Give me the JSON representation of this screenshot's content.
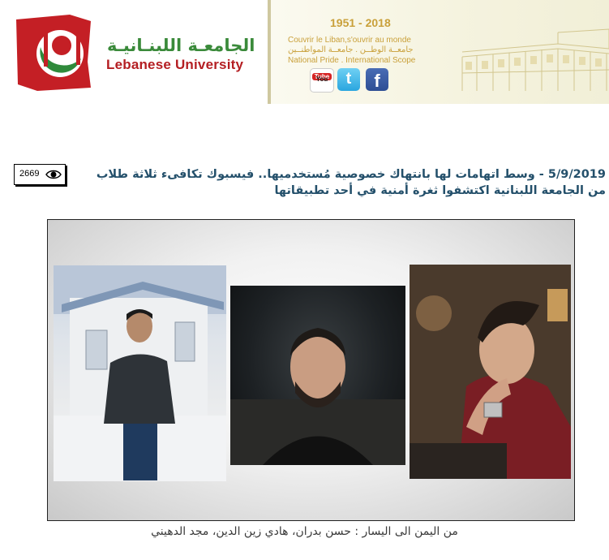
{
  "header": {
    "university_ar": "الجامعـة اللبنـانيـة",
    "university_en": "Lebanese University",
    "years": "1951 - 2018",
    "motto_fr": "Couvrir le Liban,s'ouvrir au monde",
    "motto_ar": "جامعــة الوطــن . جامعــة المواطنــين",
    "motto_en": "National Pride . International Scope",
    "social": {
      "youtube_top": "You",
      "youtube_bottom": "Tube",
      "twitter": "t",
      "facebook": "f"
    }
  },
  "article": {
    "views": "2669",
    "title": "5/9/2019 - وسط اتهامات لها بانتهاك خصوصية مُستخدميها.. فيسبوك تكافىء ثلاثة طلاب من الجامعة اللبنانية اكتشفوا ثغرة أمنية في أحد تطبيقاتها",
    "caption": "من اليمن الى اليسار : حسن بدران، هادي زين الدين، مجد الدهيني"
  },
  "colors": {
    "brand_red": "#b41e22",
    "brand_green": "#3a8a3a",
    "title_blue": "#24506b",
    "gold": "#c9a03a"
  }
}
